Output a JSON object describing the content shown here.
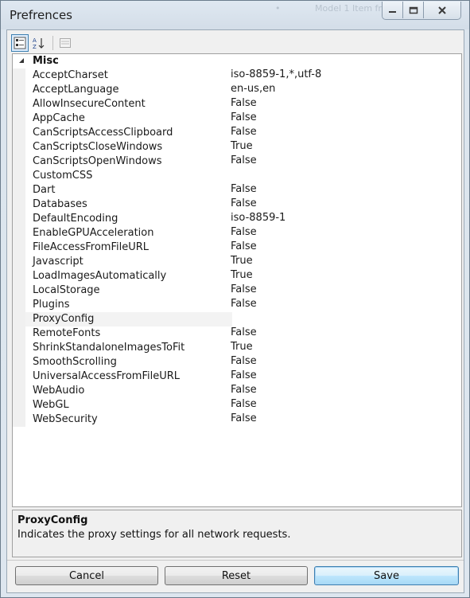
{
  "window": {
    "title": "Prefrences",
    "ghost_texts": [
      "•",
      "Model 1 Item from..."
    ]
  },
  "toolbar": {
    "categorized_icon": "categorized-view-icon",
    "alphabetical_icon": "alphabetical-sort-icon",
    "property_pages_icon": "property-pages-icon"
  },
  "grid": {
    "category": "Misc",
    "properties": [
      {
        "name": "AcceptCharset",
        "value": "iso-8859-1,*,utf-8"
      },
      {
        "name": "AcceptLanguage",
        "value": "en-us,en"
      },
      {
        "name": "AllowInsecureContent",
        "value": "False"
      },
      {
        "name": "AppCache",
        "value": "False"
      },
      {
        "name": "CanScriptsAccessClipboard",
        "value": "False"
      },
      {
        "name": "CanScriptsCloseWindows",
        "value": "True"
      },
      {
        "name": "CanScriptsOpenWindows",
        "value": "False"
      },
      {
        "name": "CustomCSS",
        "value": ""
      },
      {
        "name": "Dart",
        "value": "False"
      },
      {
        "name": "Databases",
        "value": "False"
      },
      {
        "name": "DefaultEncoding",
        "value": "iso-8859-1"
      },
      {
        "name": "EnableGPUAcceleration",
        "value": "False"
      },
      {
        "name": "FileAccessFromFileURL",
        "value": "False"
      },
      {
        "name": "Javascript",
        "value": "True"
      },
      {
        "name": "LoadImagesAutomatically",
        "value": "True"
      },
      {
        "name": "LocalStorage",
        "value": "False"
      },
      {
        "name": "Plugins",
        "value": "False"
      },
      {
        "name": "ProxyConfig",
        "value": ""
      },
      {
        "name": "RemoteFonts",
        "value": "False"
      },
      {
        "name": "ShrinkStandaloneImagesToFit",
        "value": "True"
      },
      {
        "name": "SmoothScrolling",
        "value": "False"
      },
      {
        "name": "UniversalAccessFromFileURL",
        "value": "False"
      },
      {
        "name": "WebAudio",
        "value": "False"
      },
      {
        "name": "WebGL",
        "value": "False"
      },
      {
        "name": "WebSecurity",
        "value": "False"
      }
    ],
    "selected": "ProxyConfig"
  },
  "help": {
    "title": "ProxyConfig",
    "description": "Indicates the proxy settings for all network requests."
  },
  "buttons": {
    "cancel": "Cancel",
    "reset": "Reset",
    "save": "Save"
  },
  "colors": {
    "accent": "#3c7fb1",
    "selection": "#f3f3f3"
  }
}
